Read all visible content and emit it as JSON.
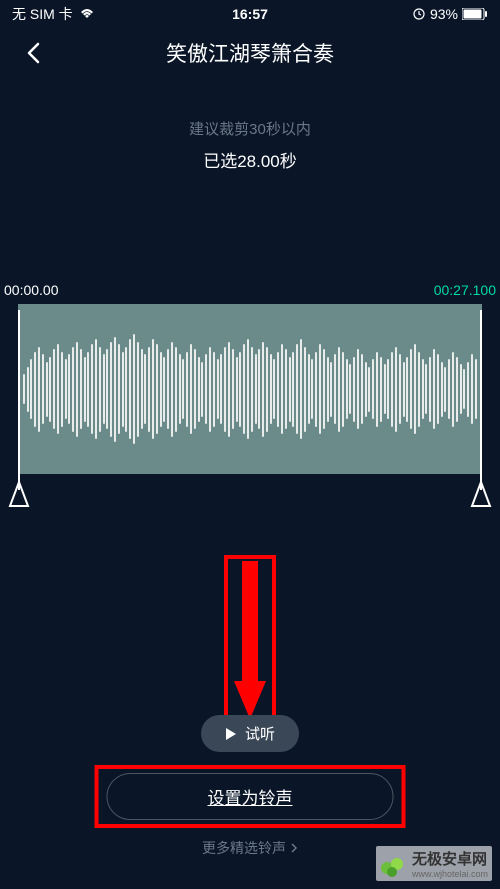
{
  "status_bar": {
    "carrier": "无 SIM 卡",
    "time": "16:57",
    "battery_pct": "93%"
  },
  "header": {
    "title": "笑傲江湖琴箫合奏"
  },
  "editor": {
    "hint": "建议裁剪30秒以内",
    "selected_duration": "已选28.00秒",
    "time_start": "00:00.00",
    "time_end": "00:27.100"
  },
  "actions": {
    "preview_label": "试听",
    "set_ringtone_label": "设置为铃声",
    "more_link": "更多精选铃声"
  },
  "watermark": {
    "text": "无极安卓网",
    "url": "www.wjhotelai.com"
  },
  "annotation": {
    "highlight_color": "#ff0000"
  }
}
